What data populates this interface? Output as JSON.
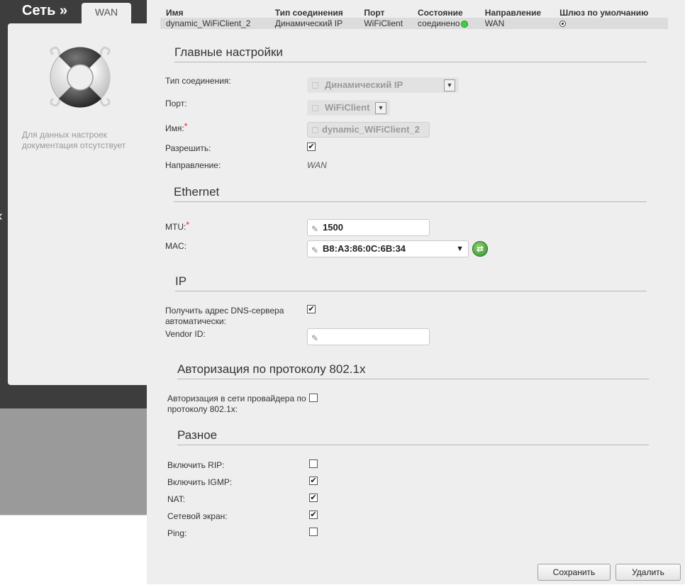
{
  "nav": {
    "section_title": "Сеть »",
    "tab": "WAN"
  },
  "help_panel": {
    "text": "Для данных настроек документация отсутствует",
    "icon": "lifebuoy-icon"
  },
  "connections_table": {
    "headers": [
      "Имя",
      "Тип соединения",
      "Порт",
      "Состояние",
      "Направление",
      "Шлюз по умолчанию"
    ],
    "row": {
      "name": "dynamic_WiFiClient_2",
      "type": "Динамический IP",
      "port": "WiFiClient",
      "state": "соединено",
      "direction": "WAN",
      "default_gateway": true
    },
    "state_color": "#3bd23b"
  },
  "main_settings": {
    "title": "Главные настройки",
    "connection_type_label": "Тип соединения:",
    "connection_type_value": "Динамический IP",
    "port_label": "Порт:",
    "port_value": "WiFiClient",
    "name_label": "Имя:",
    "name_value": "dynamic_WiFiClient_2",
    "required_mark": "*",
    "enable_label": "Разрешить:",
    "enable_checked": true,
    "direction_label": "Направление:",
    "direction_value": "WAN"
  },
  "ethernet": {
    "title": "Ethernet",
    "mtu_label": "MTU:",
    "mtu_value": "1500",
    "mac_label": "MAC:",
    "mac_value": "B8:A3:86:0C:6B:34"
  },
  "ip": {
    "title": "IP",
    "dns_auto_label": "Получить адрес DNS-сервера автоматически:",
    "dns_auto_checked": true,
    "vendor_id_label": "Vendor ID:",
    "vendor_id_value": ""
  },
  "auth_8021x": {
    "title": "Авторизация по протоколу 802.1x",
    "auth_label": "Авторизация в сети провайдера по протоколу 802.1x:",
    "auth_checked": false
  },
  "misc": {
    "title": "Разное",
    "rip_label": "Включить RIP:",
    "rip_checked": false,
    "igmp_label": "Включить IGMP:",
    "igmp_checked": true,
    "nat_label": "NAT:",
    "nat_checked": true,
    "firewall_label": "Сетевой экран:",
    "firewall_checked": true,
    "ping_label": "Ping:",
    "ping_checked": false
  },
  "actions": {
    "save_label": "Сохранить",
    "delete_label": "Удалить"
  },
  "check_glyph": "✔"
}
